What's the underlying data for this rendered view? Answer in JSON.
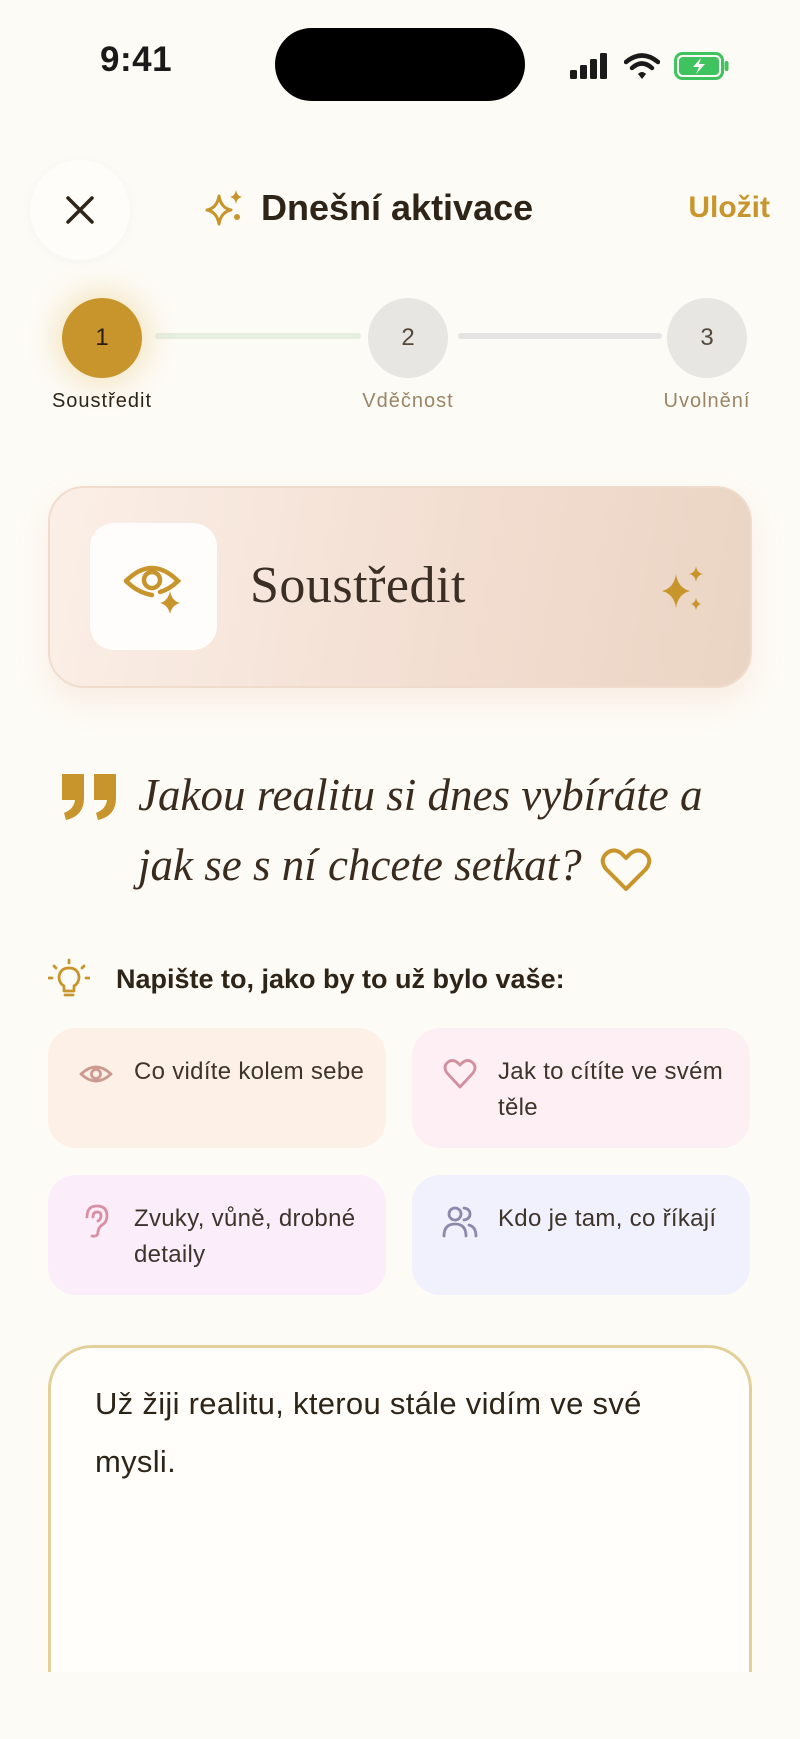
{
  "status_bar": {
    "time": "9:41"
  },
  "header": {
    "close_icon": "close-icon",
    "title": "Dnešní aktivace",
    "title_icon": "sparkles-icon",
    "save_label": "Uložit"
  },
  "stepper": {
    "steps": [
      {
        "number": "1",
        "label": "Soustředit",
        "state": "active"
      },
      {
        "number": "2",
        "label": "Vděčnost",
        "state": "inactive"
      },
      {
        "number": "3",
        "label": "Uvolnění",
        "state": "inactive"
      }
    ]
  },
  "hero": {
    "title": "Soustředit",
    "icon": "eye-sparkle-icon",
    "accent_icon": "sparkles-icon"
  },
  "question": {
    "text": "Jakou realitu si dnes vybíráte a jak se s ní chcete setkat?",
    "quote_icon": "quote-icon",
    "heart_icon": "heart-icon"
  },
  "hint": {
    "icon": "lightbulb-icon",
    "text": "Napište to, jako by to už bylo vaše:"
  },
  "chips": [
    {
      "icon": "eye-icon",
      "text": "Co vidíte kolem sebe"
    },
    {
      "icon": "heart-icon",
      "text": "Jak to cítíte ve svém těle"
    },
    {
      "icon": "ear-icon",
      "text": "Zvuky, vůně, drobné detaily"
    },
    {
      "icon": "people-icon",
      "text": "Kdo je tam, co říkají"
    }
  ],
  "entry": {
    "value": "Už žiji realitu, kterou stále vidím ve své mysli."
  },
  "colors": {
    "accent": "#c8952c",
    "background": "#fdfbf6",
    "text": "#2e2418"
  }
}
